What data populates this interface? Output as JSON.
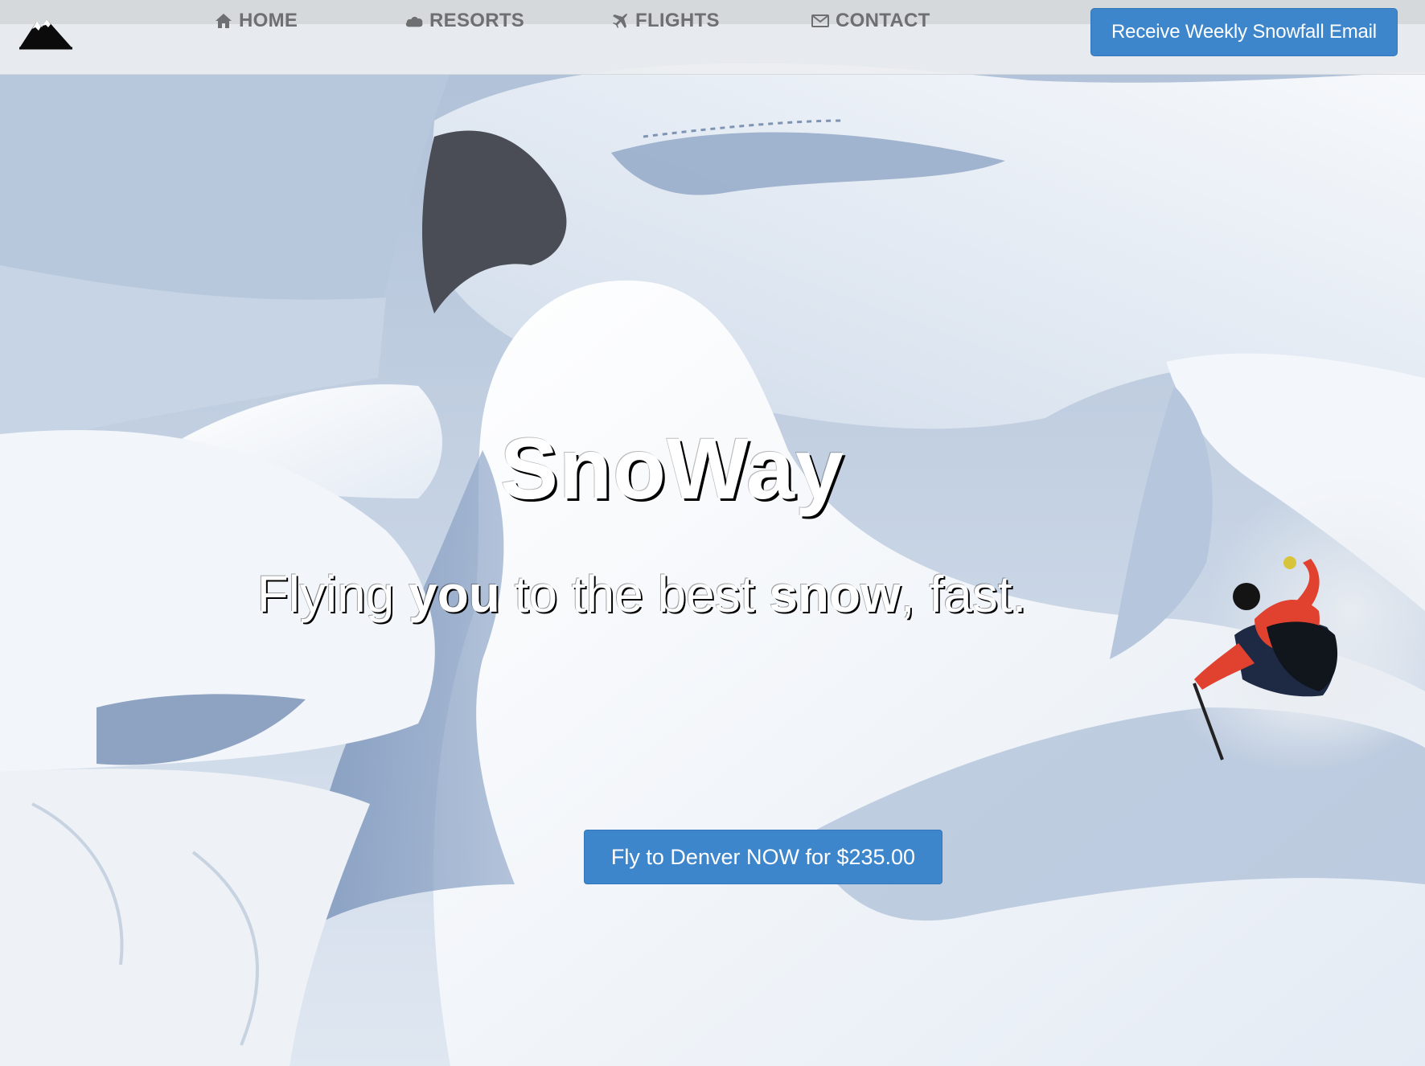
{
  "header": {
    "logo_icon": "mountain-icon",
    "nav": {
      "home": {
        "label": "HOME",
        "icon": "home-icon"
      },
      "resorts": {
        "label": "RESORTS",
        "icon": "cloud-icon"
      },
      "flights": {
        "label": "FLIGHTS",
        "icon": "plane-icon"
      },
      "contact": {
        "label": "CONTACT",
        "icon": "envelope-icon"
      }
    },
    "cta_label": "Receive Weekly Snowfall Email"
  },
  "hero": {
    "title": "SnoWay",
    "subtitle": {
      "part1": "Flying ",
      "emph1": "you",
      "part2": " to the best ",
      "emph2": "snow",
      "part3": ", fast."
    },
    "cta_label": "Fly to Denver NOW for $235.00"
  },
  "colors": {
    "primary_button": "#3d86cc",
    "nav_text": "#6d6f71",
    "navbar_bg": "#eceef0"
  }
}
